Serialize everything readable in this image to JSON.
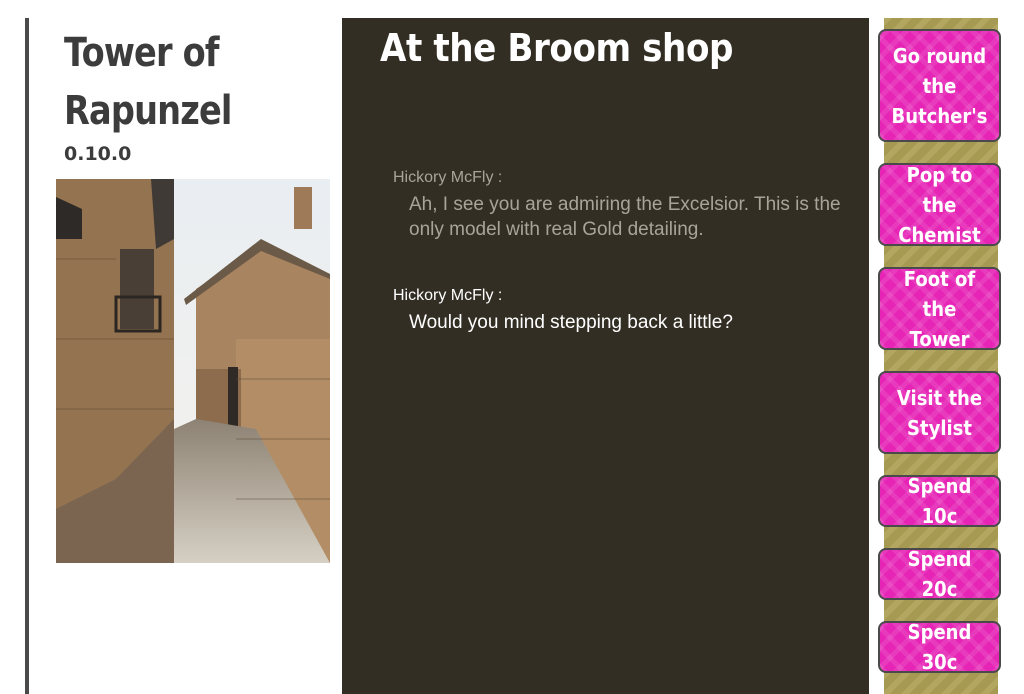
{
  "sidebar": {
    "title": "Tower of Rapunzel",
    "version": "0.10.0"
  },
  "scene": {
    "title": "At the Broom shop",
    "dialogue": [
      {
        "speaker": "Hickory McFly :",
        "text": "Ah, I see you are admiring the Excelsior. This is the only model with real Gold detailing."
      },
      {
        "speaker": "Hickory McFly :",
        "text": "Would you mind stepping back a little?"
      }
    ]
  },
  "choices": [
    {
      "label": "Go round the Butcher's"
    },
    {
      "label": "Pop to the Chemist"
    },
    {
      "label": "Foot of the Tower"
    },
    {
      "label": "Visit the Stylist"
    },
    {
      "label": "Spend 10c"
    },
    {
      "label": "Spend 20c"
    },
    {
      "label": "Spend 30c"
    }
  ],
  "colors": {
    "panel": "#332e24",
    "choice": "#e624b6",
    "rail": "#ad9f55",
    "text_dim": "#a7a49b"
  }
}
